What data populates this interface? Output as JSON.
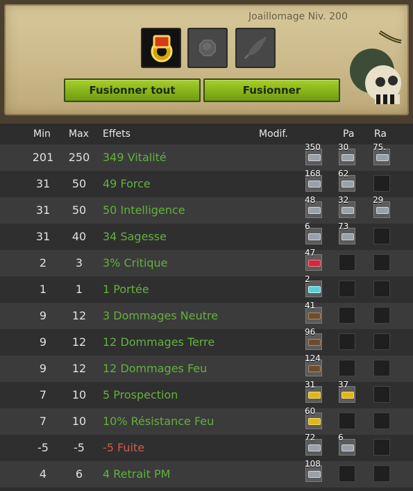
{
  "header": {
    "title": "Joaillomage Niv. 200",
    "buttons": {
      "fuse_all": "Fusionner tout",
      "fuse": "Fusionner"
    },
    "slots": [
      {
        "icon": "ring-icon"
      },
      {
        "icon": "rune-slot-icon"
      },
      {
        "icon": "feather-icon"
      }
    ]
  },
  "columns": {
    "min": "Min",
    "max": "Max",
    "effects": "Effets",
    "modif": "Modif.",
    "pa": "Pa",
    "ra": "Ra"
  },
  "rows": [
    {
      "min": "201",
      "max": "250",
      "effect": "349 Vitalité",
      "modif": "350",
      "pa": "30",
      "ra": "75.",
      "rune": "grey",
      "negative": false
    },
    {
      "min": "31",
      "max": "50",
      "effect": "49 Force",
      "modif": "168",
      "pa": "62",
      "ra": "",
      "rune": "grey",
      "negative": false
    },
    {
      "min": "31",
      "max": "50",
      "effect": "50 Intelligence",
      "modif": "48",
      "pa": "32",
      "ra": "29",
      "rune": "grey",
      "negative": false
    },
    {
      "min": "31",
      "max": "40",
      "effect": "34 Sagesse",
      "modif": "6",
      "pa": "73",
      "ra": "",
      "rune": "grey",
      "negative": false
    },
    {
      "min": "2",
      "max": "3",
      "effect": "3% Critique",
      "modif": "47",
      "pa": "",
      "ra": "",
      "rune": "pink",
      "negative": false
    },
    {
      "min": "1",
      "max": "1",
      "effect": "1 Portée",
      "modif": "2",
      "pa": "",
      "ra": "",
      "rune": "teal",
      "negative": false
    },
    {
      "min": "9",
      "max": "12",
      "effect": "3 Dommages Neutre",
      "modif": "41",
      "pa": "",
      "ra": "",
      "rune": "brown",
      "negative": false
    },
    {
      "min": "9",
      "max": "12",
      "effect": "12 Dommages Terre",
      "modif": "96",
      "pa": "",
      "ra": "",
      "rune": "brown",
      "negative": false
    },
    {
      "min": "9",
      "max": "12",
      "effect": "12 Dommages Feu",
      "modif": "124",
      "pa": "",
      "ra": "",
      "rune": "brown",
      "negative": false
    },
    {
      "min": "7",
      "max": "10",
      "effect": "5 Prospection",
      "modif": "31",
      "pa": "37",
      "ra": "",
      "rune": "gold",
      "negative": false
    },
    {
      "min": "7",
      "max": "10",
      "effect": "10% Résistance Feu",
      "modif": "60",
      "pa": "",
      "ra": "",
      "rune": "gold",
      "negative": false
    },
    {
      "min": "-5",
      "max": "-5",
      "effect": "-5 Fuite",
      "modif": "72",
      "pa": "6",
      "ra": "",
      "rune": "grey",
      "negative": true
    },
    {
      "min": "4",
      "max": "6",
      "effect": "4 Retrait PM",
      "modif": "108",
      "pa": "",
      "ra": "",
      "rune": "grey",
      "negative": false
    }
  ]
}
